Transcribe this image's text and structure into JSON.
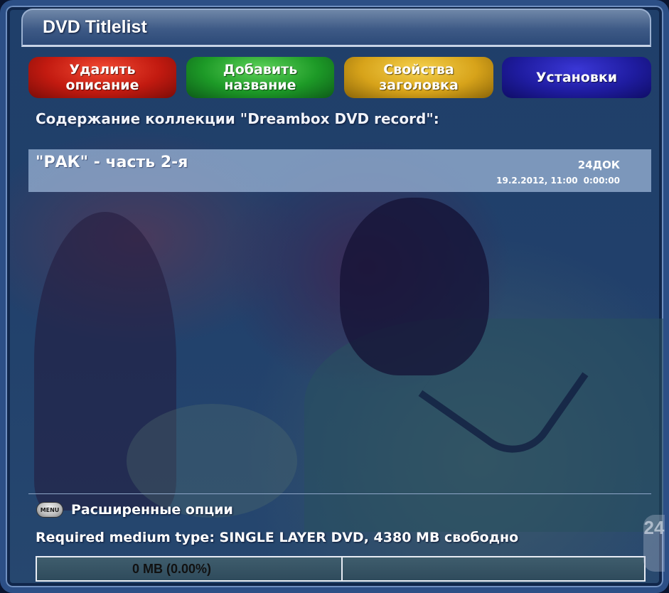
{
  "window": {
    "title": "DVD Titlelist"
  },
  "buttons": {
    "red": {
      "line1": "Удалить",
      "line2": "описание",
      "color": "#c21a10"
    },
    "green": {
      "line1": "Добавить",
      "line2": "название",
      "color": "#1d9a27"
    },
    "yellow": {
      "line1": "Свойства",
      "line2": "заголовка",
      "color": "#d7a31a"
    },
    "blue": {
      "label": "Установки",
      "color": "#1f1ca0"
    }
  },
  "collection": {
    "heading": "Содержание коллекции \"Dreambox DVD record\":"
  },
  "titles": [
    {
      "name": "\"РАК\" - часть 2-я",
      "channel": "24ДОК",
      "datetime": "19.2.2012, 11:00",
      "duration": "0:00:00",
      "selected": true
    }
  ],
  "footer": {
    "menu_icon_label": "MENU",
    "menu_label": "Расширенные опции",
    "required_medium": "Required medium type: SINGLE LAYER DVD, 4380 MB свободно",
    "space_used_label": "0 MB (0.00%)",
    "space_used_percent": 0,
    "corner_badge": "24"
  }
}
